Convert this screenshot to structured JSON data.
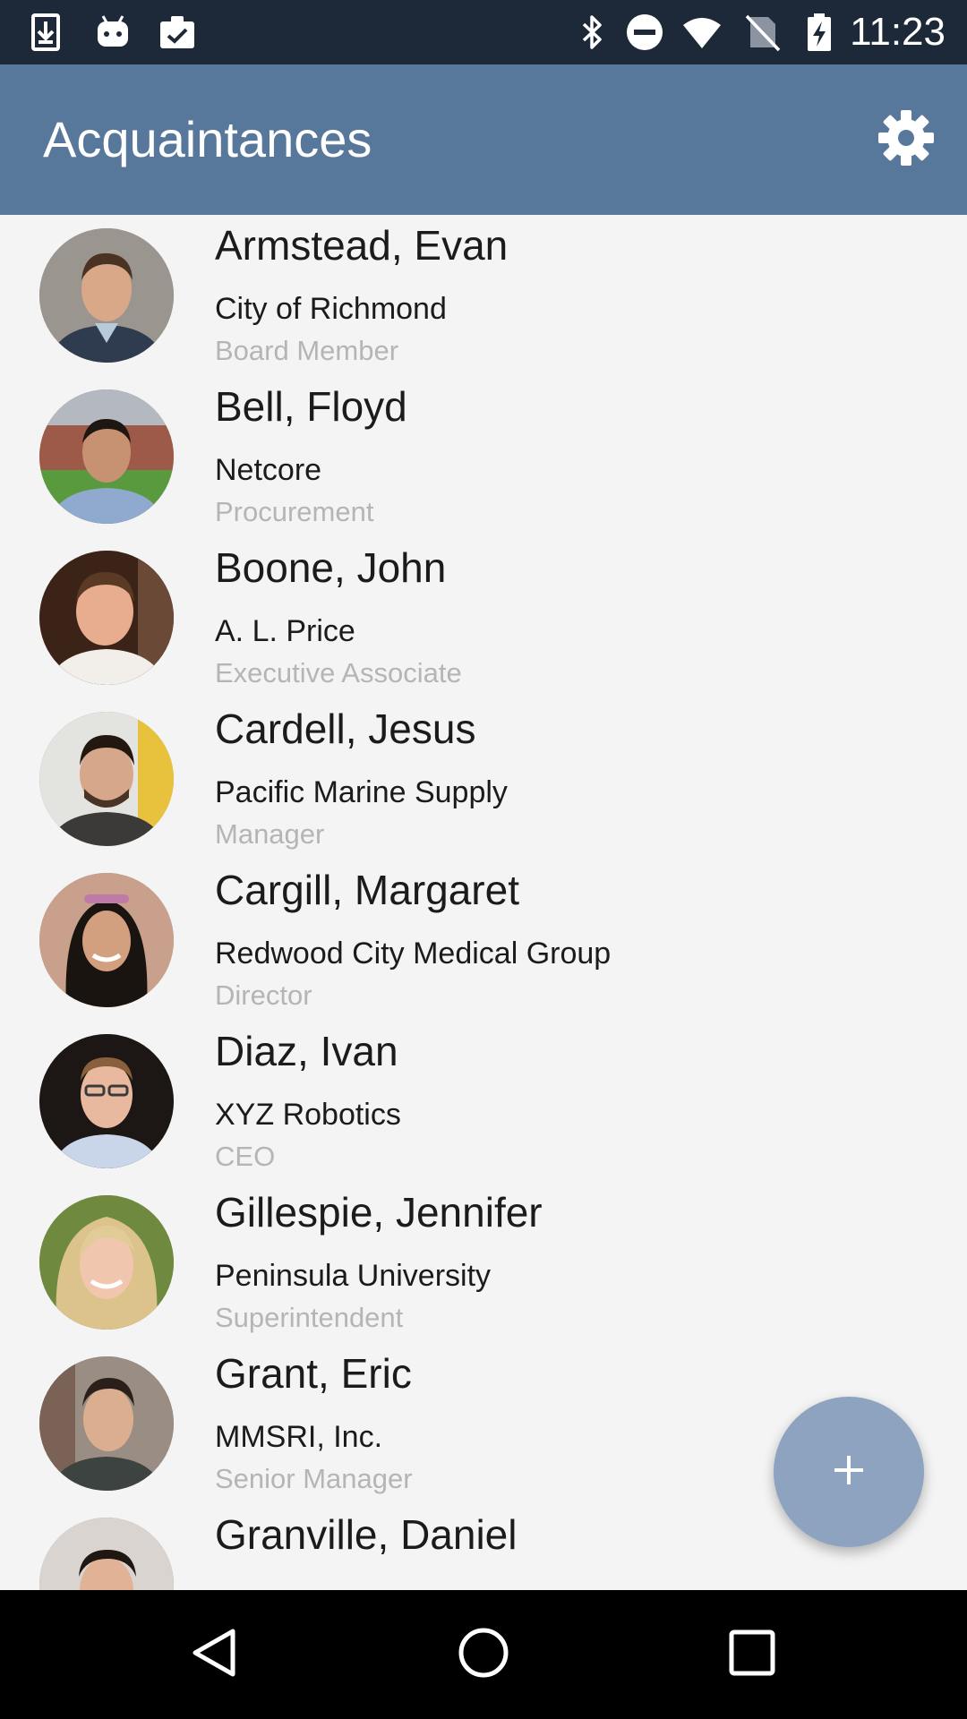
{
  "status_bar": {
    "time": "11:23",
    "left_icons": [
      "download-icon",
      "android-icon",
      "clipboard-check-icon"
    ],
    "right_icons": [
      "bluetooth-icon",
      "do-not-disturb-icon",
      "wifi-icon",
      "no-sim-icon",
      "battery-charging-icon"
    ]
  },
  "app_bar": {
    "title": "Acquaintances",
    "settings_icon": "gear-icon",
    "background": "#58789b"
  },
  "contacts": [
    {
      "name": "Armstead, Evan",
      "company": "City of Richmond",
      "role": "Board Member"
    },
    {
      "name": "Bell, Floyd",
      "company": "Netcore",
      "role": "Procurement"
    },
    {
      "name": "Boone, John",
      "company": "A. L. Price",
      "role": "Executive Associate"
    },
    {
      "name": "Cardell, Jesus",
      "company": "Pacific Marine Supply",
      "role": "Manager"
    },
    {
      "name": "Cargill, Margaret",
      "company": "Redwood City Medical Group",
      "role": "Director"
    },
    {
      "name": "Diaz, Ivan",
      "company": "XYZ Robotics",
      "role": "CEO"
    },
    {
      "name": "Gillespie, Jennifer",
      "company": "Peninsula University",
      "role": "Superintendent"
    },
    {
      "name": "Grant, Eric",
      "company": "MMSRI, Inc.",
      "role": "Senior Manager"
    },
    {
      "name": "Granville, Daniel",
      "company": "",
      "role": ""
    }
  ],
  "fab": {
    "icon": "plus-icon",
    "color": "#8da3c0"
  },
  "nav_bar": {
    "icons": [
      "back-icon",
      "home-icon",
      "recents-icon"
    ]
  }
}
